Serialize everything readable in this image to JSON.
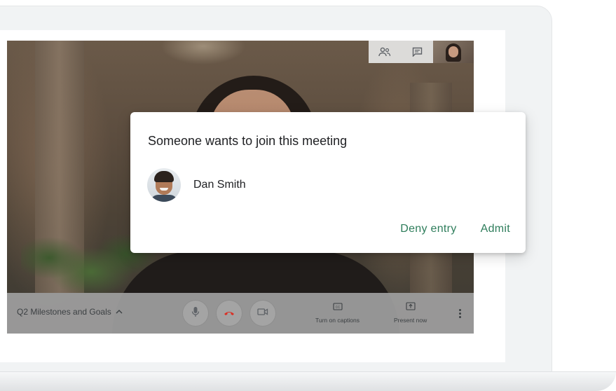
{
  "meeting": {
    "title": "Q2 Milestones and Goals"
  },
  "top_bar": {
    "icons": [
      "people-icon",
      "chat-icon"
    ]
  },
  "bottom_bar": {
    "captions_label": "Turn on captions",
    "present_label": "Present now",
    "icons": [
      "microphone-icon",
      "hangup-icon",
      "camera-icon",
      "captions-icon",
      "present-icon",
      "more-vert-icon"
    ]
  },
  "dialog": {
    "title": "Someone wants to join this meeting",
    "requester_name": "Dan Smith",
    "deny_label": "Deny entry",
    "admit_label": "Admit"
  },
  "colors": {
    "accent": "#2e7d5b",
    "hangup": "#d93025"
  }
}
